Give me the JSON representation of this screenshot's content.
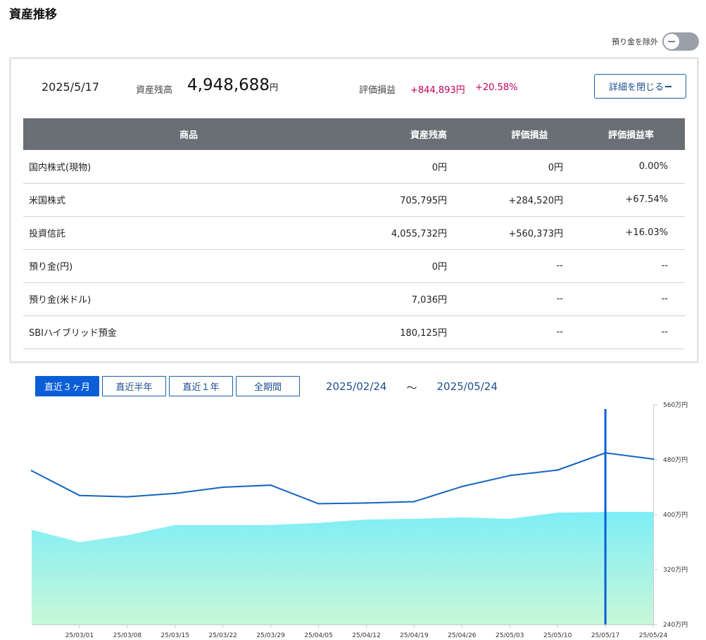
{
  "page": {
    "title": "資産推移"
  },
  "toggle": {
    "label": "預り金を除外"
  },
  "summary": {
    "date": "2025/5/17",
    "balance_label": "資産残高",
    "balance": "4,948,688",
    "balance_unit": "円",
    "pl_label": "評価損益",
    "pl": "+844,893円",
    "pl_rate": "+20.58%",
    "detail_button": "詳細を閉じる"
  },
  "table": {
    "headers": [
      "商品",
      "資産残高",
      "評価損益",
      "評価損益率"
    ],
    "rows": [
      {
        "name": "国内株式(現物)",
        "balance": "0円",
        "pl": "0円",
        "rate": "0.00%"
      },
      {
        "name": "米国株式",
        "balance": "705,795円",
        "pl": "+284,520円",
        "rate": "+67.54%"
      },
      {
        "name": "投資信託",
        "balance": "4,055,732円",
        "pl": "+560,373円",
        "rate": "+16.03%"
      },
      {
        "name": "預り金(円)",
        "balance": "0円",
        "pl": "--",
        "rate": "--"
      },
      {
        "name": "預り金(米ドル)",
        "balance": "7,036円",
        "pl": "--",
        "rate": "--"
      },
      {
        "name": "SBIハイブリッド預金",
        "balance": "180,125円",
        "pl": "--",
        "rate": "--"
      }
    ]
  },
  "range": {
    "buttons": [
      "直近３ヶ月",
      "直近半年",
      "直近１年",
      "全期間"
    ],
    "active_index": 0,
    "from": "2025/02/24",
    "separator": "～",
    "to": "2025/05/24"
  },
  "colors": {
    "accent": "#0b5ed7",
    "positive": "#c3005a",
    "line": "#1565c0",
    "area_top": "#7eeef7",
    "area_bottom": "#c8f7d8"
  },
  "chart_data": {
    "type": "area",
    "x": [
      "25/02/24",
      "25/03/01",
      "25/03/08",
      "25/03/15",
      "25/03/22",
      "25/03/29",
      "25/04/05",
      "25/04/12",
      "25/04/19",
      "25/04/26",
      "25/05/03",
      "25/05/10",
      "25/05/17",
      "25/05/24"
    ],
    "x_tick_labels": [
      "25/03/01",
      "25/03/08",
      "25/03/15",
      "25/03/22",
      "25/03/29",
      "25/04/05",
      "25/04/12",
      "25/04/19",
      "25/04/26",
      "25/05/03",
      "25/05/10",
      "25/05/17",
      "25/05/24"
    ],
    "y_tick_labels": [
      "560万円",
      "480万円",
      "400万円",
      "320万円",
      "240万円"
    ],
    "y_ticks": [
      560,
      480,
      400,
      320,
      240
    ],
    "ylim": [
      240,
      560
    ],
    "unit": "万円",
    "series": [
      {
        "type": "line",
        "values": [
          464,
          428,
          426,
          431,
          440,
          443,
          416,
          417,
          419,
          441,
          457,
          465,
          490,
          481
        ]
      },
      {
        "type": "area",
        "values": [
          378,
          360,
          370,
          385,
          385,
          385,
          388,
          393,
          394,
          396,
          394,
          403,
          404,
          404
        ]
      }
    ],
    "highlight_x": "25/05/17",
    "grid": false
  }
}
